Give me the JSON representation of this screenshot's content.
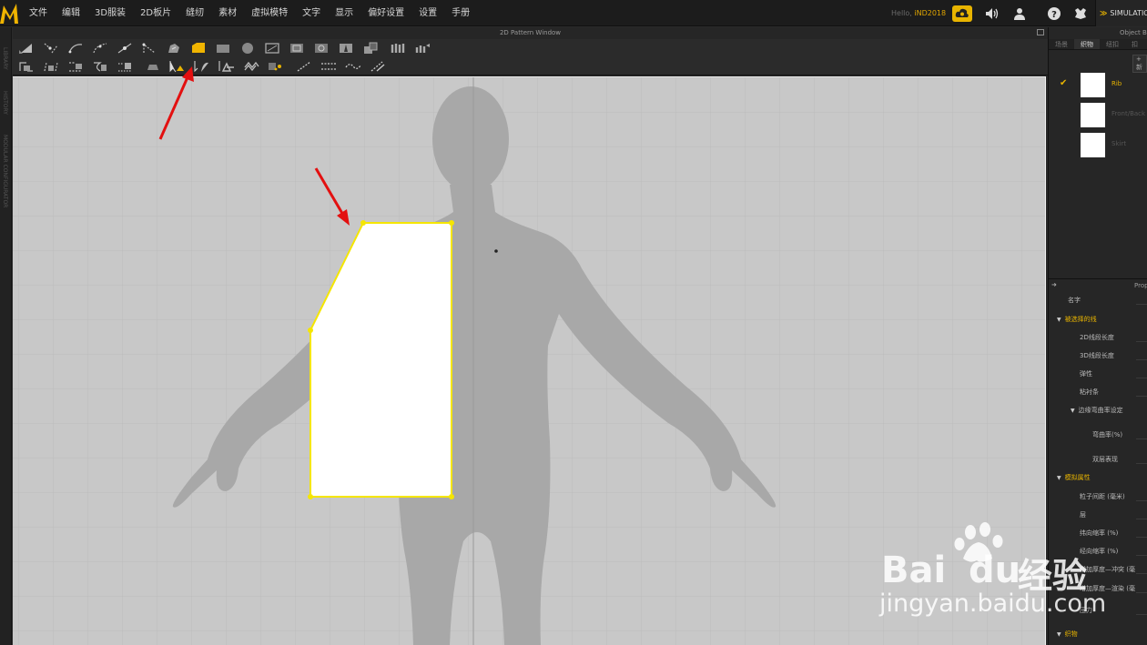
{
  "menu": {
    "items": [
      "文件",
      "编辑",
      "3D服装",
      "2D板片",
      "缝纫",
      "素材",
      "虚拟模特",
      "文字",
      "显示",
      "偏好设置",
      "设置",
      "手册"
    ],
    "hello_label": "Hello,",
    "user": "iND2018",
    "simulation_label": "SIMULATIO",
    "icons": [
      "cloud-sync-icon",
      "speaker-icon",
      "user-icon",
      "help-icon",
      "settings-icon"
    ]
  },
  "left_strip": {
    "labels": [
      "LIBRARY",
      "HISTORY",
      "MODULAR CONFIGURATOR"
    ]
  },
  "pattern_window": {
    "title": "2D Pattern Window",
    "toolbar_row1": [
      "transform-pattern-icon",
      "edit-point-icon",
      "edit-curvature-icon",
      "curve-point-icon",
      "add-point-icon",
      "edit-pattern-icon",
      "internal-polygon-icon",
      "fold-pattern-icon",
      "rectangle-icon",
      "circle-icon",
      "polygon-icon",
      "internal-rectangle-icon",
      "internal-circle-icon",
      "dart-icon",
      "seam-taping-icon",
      "gathering-icon",
      "trim-icon"
    ],
    "toolbar_row2": [
      "segment-sewing-icon",
      "free-sewing-icon",
      "check-sewing-icon",
      "m-n-sewing-icon",
      "sewing-tape-icon",
      "iron-icon",
      "select-mesh-icon",
      "edit-texture-icon",
      "button-icon",
      "buttonhole-icon",
      "topstitch-icon",
      "free-topstitch-icon",
      "piping-icon",
      "zipper-icon",
      "puckering-icon"
    ],
    "highlight_color": "#f5c400",
    "annotation_color": "#e31010"
  },
  "object_panel": {
    "title": "Object B",
    "tabs": [
      "场景",
      "织物",
      "纽扣",
      "扣"
    ],
    "active_tab": "织物",
    "add_label": "+ 新",
    "fabrics": [
      {
        "name": "Rib",
        "selected": true
      },
      {
        "name": "Front/Back",
        "selected": false
      },
      {
        "name": "Skirt",
        "selected": false
      }
    ]
  },
  "property_panel": {
    "title": "Property",
    "rows": [
      {
        "label": "名字",
        "kind": "item"
      },
      {
        "label": "被选择的线",
        "kind": "section"
      },
      {
        "label": "2D线段长度",
        "kind": "item"
      },
      {
        "label": "3D线段长度",
        "kind": "item"
      },
      {
        "label": "弹性",
        "kind": "item"
      },
      {
        "label": "粘衬条",
        "kind": "item"
      },
      {
        "label": "边缘弯曲率设定",
        "kind": "subsection"
      },
      {
        "label": "弯曲率(%)",
        "kind": "item"
      },
      {
        "label": "双层表现",
        "kind": "item"
      },
      {
        "label": "模拟属性",
        "kind": "section"
      },
      {
        "label": "粒子间距 (毫米)",
        "kind": "item"
      },
      {
        "label": "层",
        "kind": "item"
      },
      {
        "label": "纬向缩率 (%)",
        "kind": "item"
      },
      {
        "label": "经向缩率 (%)",
        "kind": "item"
      },
      {
        "label": "增加厚度—冲突 (毫",
        "kind": "item"
      },
      {
        "label": "增加厚度—渲染 (毫",
        "kind": "item"
      },
      {
        "label": "压力",
        "kind": "item"
      },
      {
        "label": "织物",
        "kind": "section"
      }
    ]
  },
  "watermark": {
    "brand_left": "Bai",
    "brand_right": "du",
    "brand_cn": "经验",
    "url": "jingyan.baidu.com"
  }
}
